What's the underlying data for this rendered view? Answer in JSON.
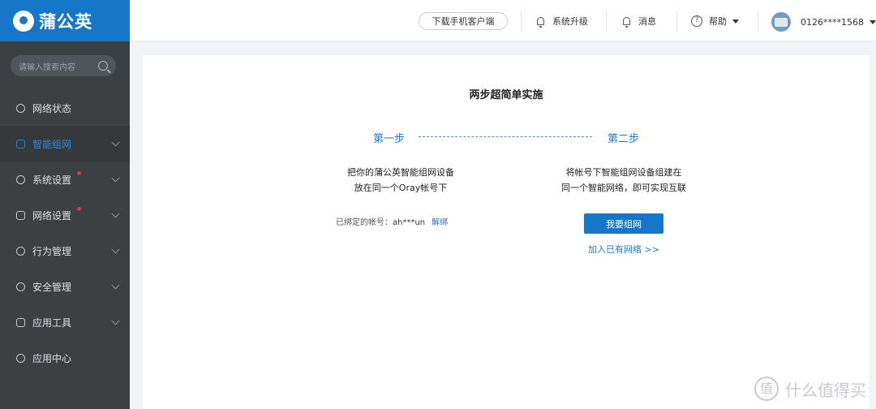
{
  "brand": {
    "name": "蒲公英"
  },
  "sidebar": {
    "search_placeholder": "请输入搜索内容",
    "items": [
      {
        "label": "网络状态",
        "icon": "network-status-icon"
      },
      {
        "label": "智能组网",
        "icon": "smart-network-icon",
        "active": true
      },
      {
        "label": "系统设置",
        "icon": "gear-icon",
        "badge": true
      },
      {
        "label": "网络设置",
        "icon": "network-settings-icon",
        "badge": true
      },
      {
        "label": "行为管理",
        "icon": "behavior-icon"
      },
      {
        "label": "安全管理",
        "icon": "shield-icon"
      },
      {
        "label": "应用工具",
        "icon": "toolbox-icon"
      },
      {
        "label": "应用中心",
        "icon": "cube-icon"
      }
    ]
  },
  "topbar": {
    "download": "下载手机客户端",
    "upgrade": "系统升级",
    "messages": "消息",
    "help": "帮助",
    "account": "0126****1568"
  },
  "main": {
    "title": "两步超简单实施",
    "step1": {
      "title": "第一步",
      "line1": "把你的蒲公英智能组网设备",
      "line2": "放在同一个Oray帐号下",
      "bound_label": "已绑定的帐号：",
      "bound_account": "ah***un",
      "unbind": "解绑"
    },
    "step2": {
      "title": "第二步",
      "line1": "将帐号下智能组网设备组建在",
      "line2": "同一个智能网络，即可实现互联",
      "button": "我要组网",
      "join_link": "加入已有网络 >>"
    }
  },
  "watermark": "什么值得买",
  "colors": {
    "accent": "#1677c9",
    "sidebar": "#3c4043",
    "badge": "#e6314d"
  }
}
